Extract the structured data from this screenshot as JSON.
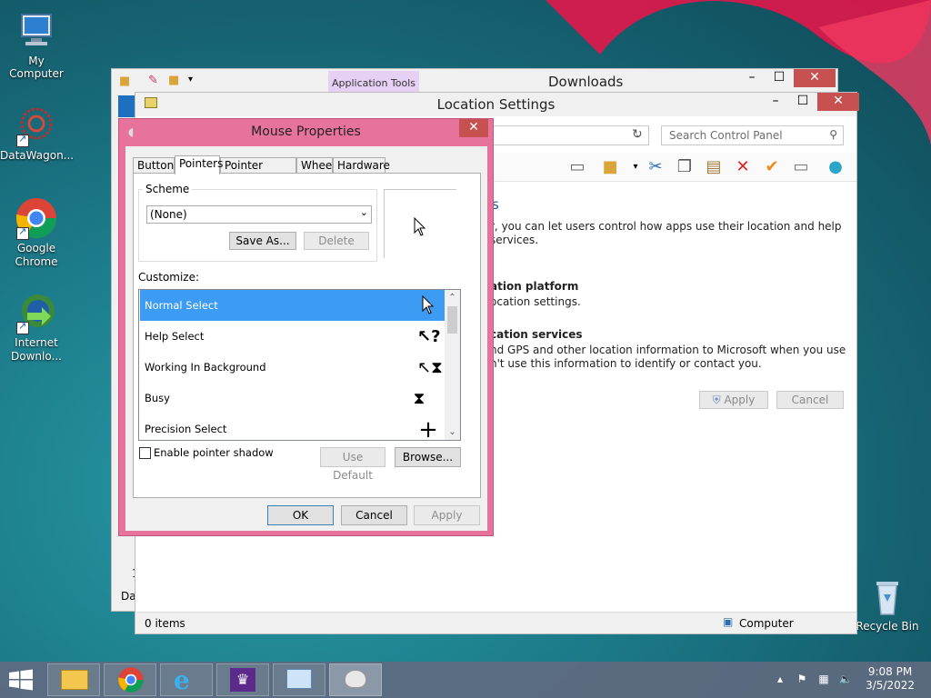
{
  "desktop": {
    "icons": [
      {
        "label": "My Computer"
      },
      {
        "label": "DataWagon..."
      },
      {
        "label": "Google Chrome"
      },
      {
        "label": "Internet Downlo..."
      },
      {
        "label": "Recycle Bin"
      }
    ]
  },
  "downloads_window": {
    "title": "Downloads",
    "ribbon_tab": "Application Tools",
    "partial_row": "1",
    "partial_label": "Dat"
  },
  "location_window": {
    "title": "Location Settings",
    "search_placeholder": "Search Control Panel",
    "heading_fragment": "s",
    "intro_line1": "r, you can let users control how apps use their location and help",
    "intro_line2": "services.",
    "platform_heading": "ation platform",
    "platform_text": "ocation settings.",
    "services_heading": "cation services",
    "services_line1": "nd GPS and other location information to Microsoft when you use",
    "services_line2": "n't use this information to identify or contact you.",
    "apply_label": "Apply",
    "cancel_label": "Cancel",
    "status_items": "0 items",
    "status_location": "Computer"
  },
  "mouse_dialog": {
    "title": "Mouse Properties",
    "tabs": [
      "Buttons",
      "Pointers",
      "Pointer Options",
      "Wheel",
      "Hardware"
    ],
    "active_tab": "Pointers",
    "scheme_label": "Scheme",
    "scheme_value": "(None)",
    "save_as_label": "Save As...",
    "delete_label": "Delete",
    "customize_label": "Customize:",
    "pointers": [
      {
        "name": "Normal Select",
        "icon": "arrow-cursor-icon"
      },
      {
        "name": "Help Select",
        "icon": "help-cursor-icon"
      },
      {
        "name": "Working In Background",
        "icon": "working-cursor-icon"
      },
      {
        "name": "Busy",
        "icon": "hourglass-icon"
      },
      {
        "name": "Precision Select",
        "icon": "crosshair-icon"
      }
    ],
    "selected_index": 0,
    "shadow_label": "Enable pointer shadow",
    "shadow_checked": false,
    "use_default_label": "Use Default",
    "browse_label": "Browse...",
    "ok_label": "OK",
    "cancel_label": "Cancel",
    "apply_label": "Apply"
  },
  "taskbar": {
    "time": "9:08 PM",
    "date": "3/5/2022"
  }
}
